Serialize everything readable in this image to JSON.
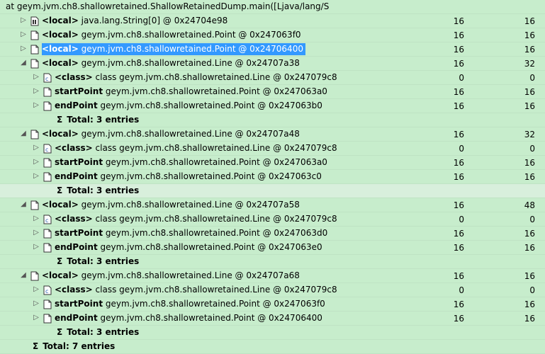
{
  "tree": {
    "header": "at geym.jvm.ch8.shallowretained.ShallowRetainedDump.main([Ljava/lang/S",
    "rows": [
      {
        "depth": 1,
        "toggle": "▷",
        "icon": "array",
        "kw": "<local>",
        "text": "java.lang.String[0] @ 0x24704e98",
        "v1": "16",
        "v2": "16"
      },
      {
        "depth": 1,
        "toggle": "▷",
        "icon": "object",
        "kw": "<local>",
        "text": "geym.jvm.ch8.shallowretained.Point @ 0x247063f0",
        "v1": "16",
        "v2": "16"
      },
      {
        "depth": 1,
        "toggle": "▷",
        "icon": "object",
        "kw": "<local>",
        "text": "geym.jvm.ch8.shallowretained.Point @ 0x24706400",
        "v1": "16",
        "v2": "16",
        "selected": true
      },
      {
        "depth": 1,
        "toggle": "◢",
        "icon": "object",
        "kw": "<local>",
        "text": "geym.jvm.ch8.shallowretained.Line @ 0x24707a38",
        "v1": "16",
        "v2": "32"
      },
      {
        "depth": 2,
        "toggle": "▷",
        "icon": "class",
        "kw": "<class>",
        "text": "class geym.jvm.ch8.shallowretained.Line @ 0x247079c8",
        "v1": "0",
        "v2": "0"
      },
      {
        "depth": 2,
        "toggle": "▷",
        "icon": "object",
        "kw": "startPoint",
        "text": "geym.jvm.ch8.shallowretained.Point @ 0x247063a0",
        "v1": "16",
        "v2": "16"
      },
      {
        "depth": 2,
        "toggle": "▷",
        "icon": "object",
        "kw": "endPoint",
        "text": "geym.jvm.ch8.shallowretained.Point @ 0x247063b0",
        "v1": "16",
        "v2": "16"
      },
      {
        "depth": 2,
        "total": true,
        "kw": "Total: 3 entries",
        "text": "",
        "v1": "",
        "v2": ""
      },
      {
        "depth": 1,
        "toggle": "◢",
        "icon": "object",
        "kw": "<local>",
        "text": "geym.jvm.ch8.shallowretained.Line @ 0x24707a48",
        "v1": "16",
        "v2": "32"
      },
      {
        "depth": 2,
        "toggle": "▷",
        "icon": "class",
        "kw": "<class>",
        "text": "class geym.jvm.ch8.shallowretained.Line @ 0x247079c8",
        "v1": "0",
        "v2": "0"
      },
      {
        "depth": 2,
        "toggle": "▷",
        "icon": "object",
        "kw": "startPoint",
        "text": "geym.jvm.ch8.shallowretained.Point @ 0x247063a0",
        "v1": "16",
        "v2": "16"
      },
      {
        "depth": 2,
        "toggle": "▷",
        "icon": "object",
        "kw": "endPoint",
        "text": "geym.jvm.ch8.shallowretained.Point @ 0x247063c0",
        "v1": "16",
        "v2": "16"
      },
      {
        "depth": 2,
        "total": true,
        "kw": "Total: 3 entries",
        "text": "",
        "v1": "",
        "v2": "",
        "band": true
      },
      {
        "depth": 1,
        "toggle": "◢",
        "icon": "object",
        "kw": "<local>",
        "text": "geym.jvm.ch8.shallowretained.Line @ 0x24707a58",
        "v1": "16",
        "v2": "48"
      },
      {
        "depth": 2,
        "toggle": "▷",
        "icon": "class",
        "kw": "<class>",
        "text": "class geym.jvm.ch8.shallowretained.Line @ 0x247079c8",
        "v1": "0",
        "v2": "0"
      },
      {
        "depth": 2,
        "toggle": "▷",
        "icon": "object",
        "kw": "startPoint",
        "text": "geym.jvm.ch8.shallowretained.Point @ 0x247063d0",
        "v1": "16",
        "v2": "16"
      },
      {
        "depth": 2,
        "toggle": "▷",
        "icon": "object",
        "kw": "endPoint",
        "text": "geym.jvm.ch8.shallowretained.Point @ 0x247063e0",
        "v1": "16",
        "v2": "16"
      },
      {
        "depth": 2,
        "total": true,
        "kw": "Total: 3 entries",
        "text": "",
        "v1": "",
        "v2": ""
      },
      {
        "depth": 1,
        "toggle": "◢",
        "icon": "object",
        "kw": "<local>",
        "text": "geym.jvm.ch8.shallowretained.Line @ 0x24707a68",
        "v1": "16",
        "v2": "16"
      },
      {
        "depth": 2,
        "toggle": "▷",
        "icon": "class",
        "kw": "<class>",
        "text": "class geym.jvm.ch8.shallowretained.Line @ 0x247079c8",
        "v1": "0",
        "v2": "0"
      },
      {
        "depth": 2,
        "toggle": "▷",
        "icon": "object",
        "kw": "startPoint",
        "text": "geym.jvm.ch8.shallowretained.Point @ 0x247063f0",
        "v1": "16",
        "v2": "16"
      },
      {
        "depth": 2,
        "toggle": "▷",
        "icon": "object",
        "kw": "endPoint",
        "text": "geym.jvm.ch8.shallowretained.Point @ 0x24706400",
        "v1": "16",
        "v2": "16"
      },
      {
        "depth": 2,
        "total": true,
        "kw": "Total: 3 entries",
        "text": "",
        "v1": "",
        "v2": ""
      },
      {
        "depth": 0,
        "total": true,
        "kw": "Total: 7 entries",
        "text": "",
        "v1": "",
        "v2": ""
      }
    ]
  },
  "colors": {
    "background": "#c7edcc",
    "selection": "#3399ff",
    "band": "#d8efdc"
  }
}
